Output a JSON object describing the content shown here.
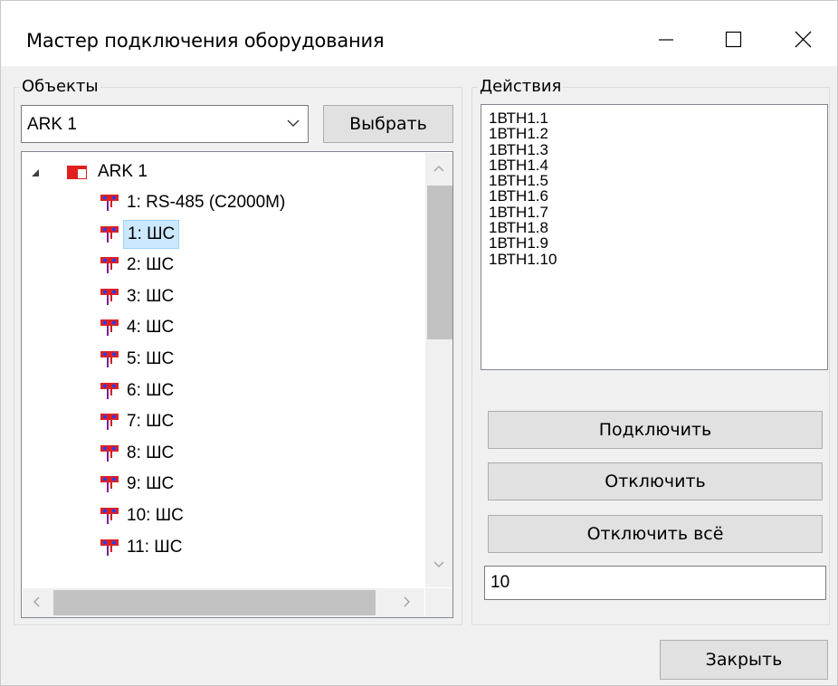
{
  "window": {
    "title": "Мастер подключения оборудования",
    "minimize_icon": "minimize-icon",
    "maximize_icon": "maximize-icon",
    "close_icon": "close-icon"
  },
  "objects": {
    "group_label": "Объекты",
    "device_select": {
      "value": "ARK 1",
      "icon": "chevron-down-icon"
    },
    "select_button": "Выбрать",
    "tree": {
      "root": {
        "label": "ARK 1",
        "icon": "device-icon",
        "expanded": true
      },
      "children": [
        {
          "label": "1: RS-485 (С2000М)",
          "icon": "zone-icon",
          "selected": false
        },
        {
          "label": "1: ШС",
          "icon": "zone-icon",
          "selected": true
        },
        {
          "label": "2: ШС",
          "icon": "zone-icon",
          "selected": false
        },
        {
          "label": "3: ШС",
          "icon": "zone-icon",
          "selected": false
        },
        {
          "label": "4: ШС",
          "icon": "zone-icon",
          "selected": false
        },
        {
          "label": "5: ШС",
          "icon": "zone-icon",
          "selected": false
        },
        {
          "label": "6: ШС",
          "icon": "zone-icon",
          "selected": false
        },
        {
          "label": "7: ШС",
          "icon": "zone-icon",
          "selected": false
        },
        {
          "label": "8: ШС",
          "icon": "zone-icon",
          "selected": false
        },
        {
          "label": "9: ШС",
          "icon": "zone-icon",
          "selected": false
        },
        {
          "label": "10: ШС",
          "icon": "zone-icon",
          "selected": false
        },
        {
          "label": "11: ШС",
          "icon": "zone-icon",
          "selected": false
        }
      ]
    }
  },
  "actions": {
    "group_label": "Действия",
    "items": [
      "1ВТН1.1",
      "1ВТН1.2",
      "1ВТН1.3",
      "1ВТН1.4",
      "1ВТН1.5",
      "1ВТН1.6",
      "1ВТН1.7",
      "1ВТН1.8",
      "1ВТН1.9",
      "1ВТН1.10"
    ],
    "connect_button": "Подключить",
    "disconnect_button": "Отключить",
    "disconnect_all_button": "Отключить всё",
    "count_value": "10"
  },
  "footer": {
    "close_button": "Закрыть"
  },
  "colors": {
    "selection_bg": "#cce8ff",
    "selection_border": "#99d1ff",
    "device_red": "#e02020"
  }
}
